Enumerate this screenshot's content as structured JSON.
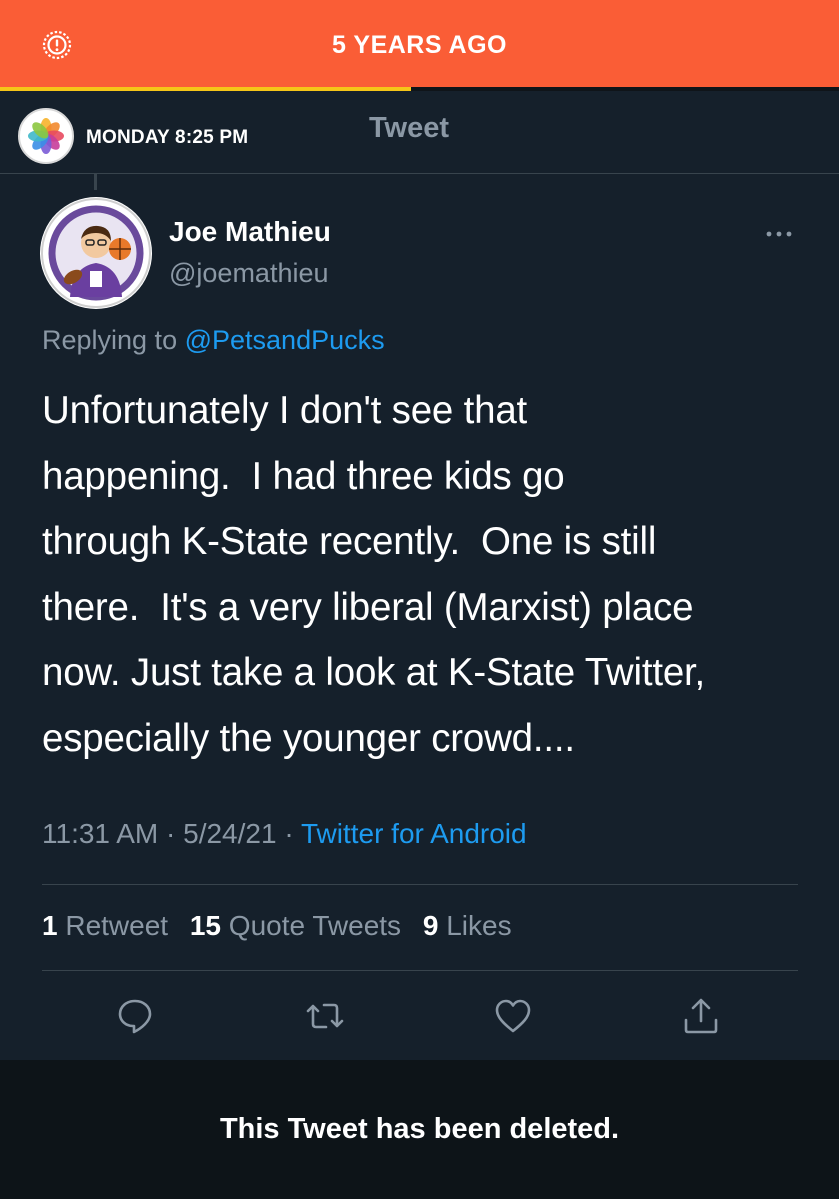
{
  "banner": {
    "title": "5 YEARS AGO",
    "progress": 0.49,
    "background_color": "#fa5d36",
    "progress_color": "#f5c518",
    "icon": "alert-circle-icon"
  },
  "memory": {
    "app_icon": "photos-icon",
    "date_label": "MONDAY",
    "time_label": "8:25 PM"
  },
  "header": {
    "title": "Tweet"
  },
  "tweet": {
    "author_name": "Joe Mathieu",
    "author_handle": "@joemathieu",
    "replying_prefix": "Replying to",
    "replying_to": "@PetsandPucks",
    "body_lines": [
      "Unfortunately I don't see that",
      "happening.  I had three kids go",
      "through K-State recently.  One is still",
      "there.  It's a very liberal (Marxist) place",
      "now. Just take a look at K-State Twitter,",
      "especially the younger crowd...."
    ],
    "time": "11:31 AM",
    "date": "5/24/21",
    "separator": "·",
    "source": "Twitter for Android",
    "stats": {
      "retweets_count": "1",
      "retweets_label": "Retweet",
      "quotes_count": "15",
      "quotes_label": "Quote Tweets",
      "likes_count": "9",
      "likes_label": "Likes"
    },
    "actions": [
      "reply-icon",
      "retweet-icon",
      "like-icon",
      "share-icon"
    ]
  },
  "footer": {
    "deleted_message": "This Tweet has been deleted."
  },
  "colors": {
    "background": "#15202b",
    "secondary_text": "#8b98a5",
    "link": "#1d9bf0",
    "divider": "#38444d"
  }
}
